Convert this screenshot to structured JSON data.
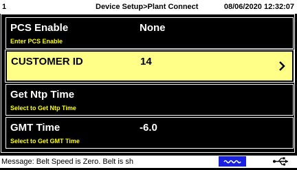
{
  "header": {
    "page_number": "1",
    "breadcrumb": "Device Setup>Plant Connect",
    "timestamp": "08/06/2020 12:32:07"
  },
  "rows": [
    {
      "label": "PCS Enable",
      "value": "None",
      "hint": "Enter PCS Enable"
    },
    {
      "label": "CUSTOMER ID",
      "value": "14",
      "hint": ""
    },
    {
      "label": "Get Ntp Time",
      "value": "",
      "hint": "Select to Get Ntp Time"
    },
    {
      "label": "GMT Time",
      "value": "-6.0",
      "hint": "Select to Get GMT Time"
    }
  ],
  "status": {
    "message": "Message: Belt Speed is Zero. Belt is sh",
    "icons": [
      "belt-wave-icon",
      "usb-icon"
    ]
  },
  "colors": {
    "selected_row": "#ffff88",
    "hint_text": "#ffff00",
    "wave_icon_bg": "#1a22e0"
  }
}
